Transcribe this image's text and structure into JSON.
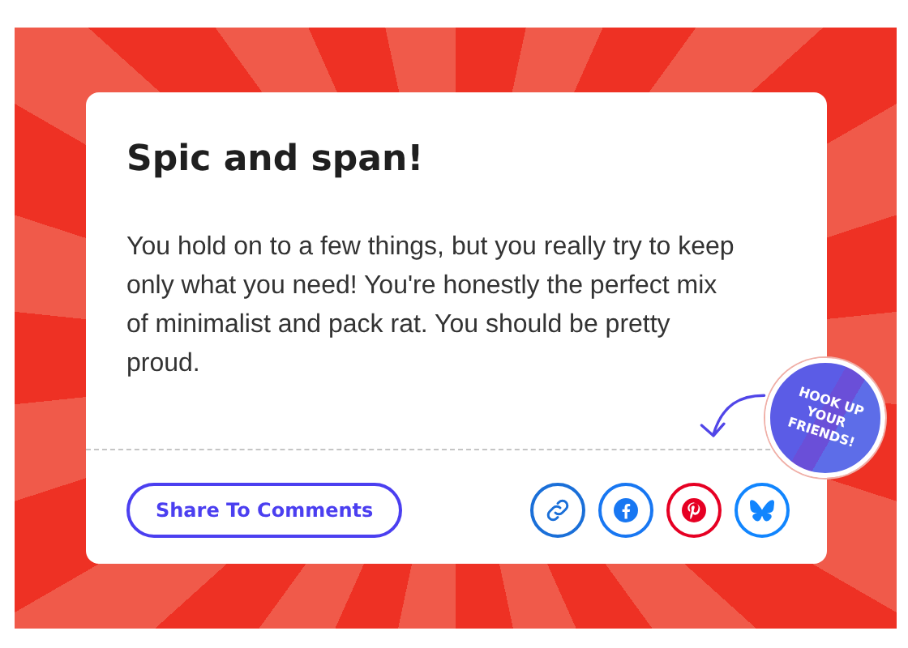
{
  "result": {
    "title": "Spic and span!",
    "description": "You hold on to a few things, but you really try to keep only what you need! You're honestly the perfect mix of minimalist and pack rat. You should be pretty proud."
  },
  "share_button": {
    "label": "Share To Comments"
  },
  "share_icons": [
    {
      "kind": "link",
      "color": "#1a6fd8"
    },
    {
      "kind": "facebook",
      "color": "#1877f2"
    },
    {
      "kind": "pinterest",
      "color": "#e60023"
    },
    {
      "kind": "bluesky",
      "color": "#1185fe"
    }
  ],
  "badge": {
    "lines": [
      "HOOK UP",
      "YOUR",
      "FRIENDS!"
    ]
  }
}
